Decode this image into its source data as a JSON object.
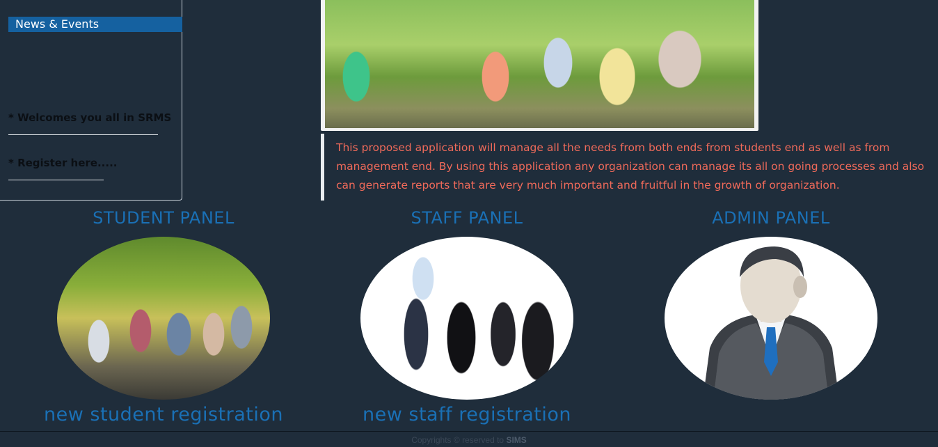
{
  "news": {
    "header": "News & Events",
    "items": [
      "* Welcomes you all in SRMS",
      "* Register here....."
    ]
  },
  "description": "This proposed application will manage all the needs from both ends from students end as well as from management end. By using this application any organization can manage its all on going processes and also can generate reports that are very much important and fruitful in the growth of organization.",
  "panels": {
    "student": {
      "title": "STUDENT PANEL",
      "link": "new student registration"
    },
    "staff": {
      "title": "STAFF PANEL",
      "link": "new staff registration"
    },
    "admin": {
      "title": "ADMIN PANEL"
    }
  },
  "footer": {
    "text": "Copyrights © reserved to ",
    "brand": "SIMS"
  },
  "colors": {
    "background": "#1f2d3b",
    "accent_blue": "#1a70b5",
    "news_header": "#1561a0",
    "description_text": "#f06a5a"
  }
}
